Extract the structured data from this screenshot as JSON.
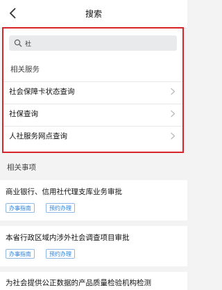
{
  "header": {
    "title": "搜索",
    "back_icon": "chevron-left-icon"
  },
  "search": {
    "value": "社",
    "icon": "search-icon"
  },
  "related_services": {
    "label": "相关服务",
    "items": [
      {
        "label": "社会保障卡状态查询"
      },
      {
        "label": "社保查询"
      },
      {
        "label": "人社服务网点查询"
      }
    ]
  },
  "related_matters": {
    "label": "相关事项",
    "items": [
      {
        "title": "商业银行、信用社代理支库业务审批",
        "tags": [
          "办事指南",
          "预约办理"
        ]
      },
      {
        "title": "本省行政区域内涉外社会调查项目审批",
        "tags": [
          "办事指南",
          "预约办理"
        ]
      },
      {
        "title": "为社会提供公正数据的产品质量检验机构检测",
        "tags": []
      }
    ]
  },
  "colors": {
    "highlight_border": "#d9252a",
    "tag_blue": "#2f7fd6",
    "page_bg": "#f3f3f3"
  }
}
